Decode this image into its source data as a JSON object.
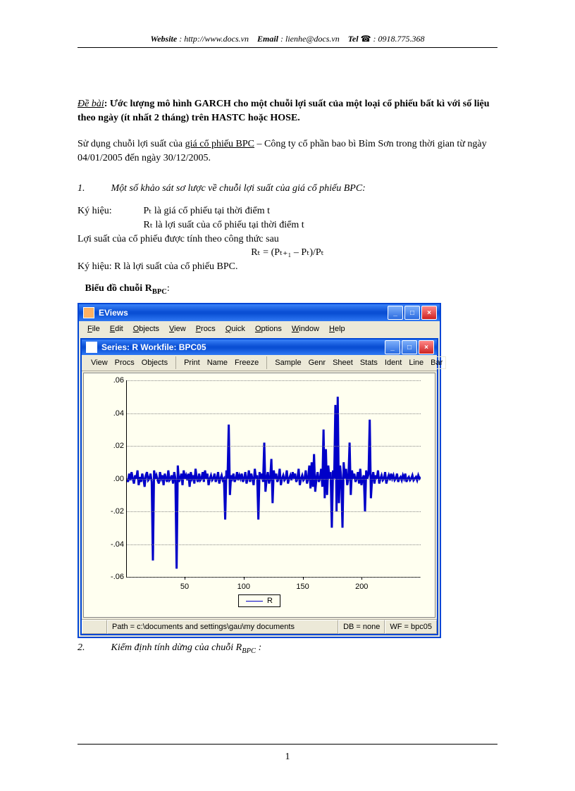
{
  "header": {
    "website_label": "Website",
    "website_value": ": http://www.docs.vn",
    "email_label": "Email",
    "email_value": ": lienhe@docs.vn",
    "tel_label": "Tel",
    "tel_icon": "☎",
    "tel_value": ": 0918.775.368"
  },
  "de_bai": {
    "label": "Đề bài",
    "body": ": Ước lượng mô hình GARCH cho một chuỗi lợi suất của một loại cổ phiếu bất kì với số liệu theo ngày (ít nhất 2 tháng) trên HASTC hoặc HOSE."
  },
  "intro": {
    "pre": "Sử dụng chuỗi lợi suất của ",
    "link": "giá cổ phiếu BPC",
    "post": " – Công ty cổ phần bao bì Bỉm Sơn trong thời gian từ ngày 04/01/2005 đến ngày 30/12/2005."
  },
  "sec1": {
    "num": "1.",
    "title": "Một số khảo sát sơ lược về chuỗi lợi suất của giá cổ phiếu BPC:",
    "ky_hieu": "Ký hiệu:",
    "p_def": "Pₜ là giá cổ phiếu tại thời điểm t",
    "r_def": "Rₜ là lợi suất của cổ phiếu tại thời điểm t",
    "loi_suat": "Lợi suất của cổ phiếu được tính theo công thức sau",
    "formula": "Rₜ = (Pₜ₊₁ – Pₜ)/Pₜ",
    "ky_hieu2": "Ký hiệu:  R là lợi suất của cổ phiếu BPC.",
    "chart_title_pre": "Biểu đồ chuỗi R",
    "chart_title_sub": "BPC",
    "chart_title_post": ":"
  },
  "eviews": {
    "app_title": "EViews",
    "inner_title": "Series: R   Workfile: BPC05",
    "menubar": [
      "File",
      "Edit",
      "Objects",
      "View",
      "Procs",
      "Quick",
      "Options",
      "Window",
      "Help"
    ],
    "toolbar_groups": [
      [
        "View",
        "Procs",
        "Objects"
      ],
      [
        "Print",
        "Name",
        "Freeze"
      ],
      [
        "Sample",
        "Genr",
        "Sheet",
        "Stats",
        "Ident",
        "Line",
        "Bar"
      ]
    ],
    "legend": "R",
    "status": {
      "path": "Path = c:\\documents and settings\\gau\\my documents",
      "db": "DB = none",
      "wf": "WF = bpc05"
    },
    "win_btn_min": "_",
    "win_btn_max": "□",
    "win_btn_close": "×"
  },
  "chart_data": {
    "type": "line",
    "title": "",
    "xlabel": "",
    "ylabel": "",
    "xlim": [
      1,
      250
    ],
    "ylim": [
      -0.06,
      0.06
    ],
    "yticks": [
      -0.06,
      -0.04,
      -0.02,
      0.0,
      0.02,
      0.04,
      0.06
    ],
    "ytick_labels": [
      "-.06",
      "-.04",
      "-.02",
      ".00",
      ".02",
      ".04",
      ".06"
    ],
    "xticks": [
      50,
      100,
      150,
      200
    ],
    "xtick_labels": [
      "50",
      "100",
      "150",
      "200"
    ],
    "series": [
      {
        "name": "R",
        "color": "#0000c8",
        "values": [
          0.0,
          -0.002,
          0.003,
          -0.001,
          0.004,
          0.0,
          -0.003,
          0.002,
          0.0,
          0.005,
          -0.004,
          0.001,
          -0.002,
          0.003,
          0.0,
          -0.005,
          0.002,
          0.004,
          -0.001,
          0.0,
          0.003,
          -0.002,
          -0.05,
          0.005,
          0.0,
          0.002,
          -0.001,
          -0.003,
          0.004,
          0.0,
          0.002,
          -0.004,
          0.003,
          0.0,
          -0.002,
          0.005,
          -0.001,
          0.0,
          0.002,
          -0.003,
          0.004,
          0.0,
          -0.055,
          0.008,
          -0.002,
          0.0,
          0.003,
          -0.004,
          0.005,
          0.0,
          0.002,
          -0.001,
          0.003,
          -0.005,
          0.004,
          0.0,
          0.002,
          -0.003,
          0.006,
          0.0,
          -0.002,
          0.003,
          -0.001,
          0.0,
          0.004,
          -0.002,
          0.005,
          0.0,
          0.003,
          -0.004,
          0.0,
          0.002,
          -0.001,
          0.0,
          0.003,
          -0.002,
          0.0,
          0.004,
          -0.003,
          0.0,
          0.002,
          -0.001,
          0.0,
          -0.025,
          0.005,
          0.0,
          0.033,
          -0.01,
          0.002,
          0.0,
          0.003,
          -0.002,
          0.0,
          0.004,
          -0.001,
          0.002,
          0.0,
          0.003,
          -0.002,
          0.0,
          0.004,
          -0.003,
          0.0,
          0.005,
          -0.002,
          0.003,
          0.0,
          -0.004,
          0.006,
          0.0,
          0.002,
          -0.025,
          0.004,
          0.0,
          0.003,
          -0.002,
          0.022,
          -0.008,
          0.0,
          0.004,
          -0.003,
          0.0,
          0.012,
          -0.015,
          0.005,
          0.0,
          0.003,
          -0.002,
          0.0,
          0.006,
          -0.004,
          0.0,
          0.002,
          -0.001,
          0.0,
          0.005,
          -0.003,
          0.0,
          0.002,
          -0.001,
          0.004,
          0.0,
          0.003,
          -0.002,
          0.0,
          0.006,
          -0.004,
          0.0,
          0.002,
          -0.001,
          0.0,
          0.005,
          -0.003,
          0.0,
          0.008,
          -0.006,
          0.01,
          -0.005,
          0.015,
          -0.008,
          0.0,
          0.004,
          -0.002,
          0.0,
          0.006,
          -0.005,
          0.03,
          -0.012,
          0.018,
          -0.01,
          0.008,
          0.0,
          0.004,
          -0.03,
          0.005,
          0.0,
          0.045,
          -0.02,
          0.05,
          -0.015,
          0.008,
          0.0,
          -0.03,
          0.01,
          0.0,
          0.006,
          -0.004,
          0.0,
          0.022,
          -0.01,
          0.005,
          0.0,
          0.003,
          -0.002,
          0.0,
          0.004,
          -0.003,
          0.006,
          -0.004,
          0.0,
          0.002,
          -0.02,
          0.005,
          0.0,
          0.003,
          0.036,
          -0.012,
          0.0,
          0.004,
          -0.003,
          0.002,
          0.0,
          0.005,
          -0.003,
          0.0,
          0.002,
          -0.001,
          0.0,
          0.004,
          -0.003,
          0.0,
          0.002,
          -0.001,
          0.003,
          0.0,
          0.002,
          -0.001,
          0.0,
          0.003,
          -0.002,
          0.0,
          0.001,
          -0.001,
          0.002,
          0.0,
          0.003,
          -0.002,
          0.0,
          0.001,
          -0.001,
          0.0,
          0.002,
          -0.001,
          0.0,
          0.001,
          -0.001,
          0.002,
          0.0,
          0.001
        ]
      }
    ]
  },
  "sec2": {
    "num": "2.",
    "title_pre": "Kiểm định tính dừng của chuỗi R",
    "title_sub": "BPC",
    "title_post": " :"
  },
  "page_number": "1"
}
